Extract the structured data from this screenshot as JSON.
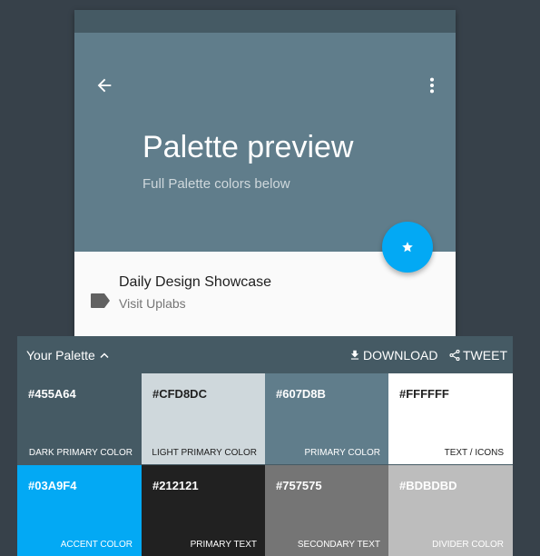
{
  "preview": {
    "title": "Palette preview",
    "subtitle": "Full Palette colors below",
    "list_item_title": "Daily Design Showcase",
    "list_item_subtitle": "Visit Uplabs",
    "icons": {
      "back": "arrow-back-icon",
      "more": "more-vert-icon",
      "fab": "star-icon",
      "label": "label-icon"
    }
  },
  "palette": {
    "title": "Your Palette",
    "download_label": "DOWNLOAD",
    "tweet_label": "TWEET",
    "swatches": [
      {
        "hex": "#455A64",
        "name": "DARK PRIMARY COLOR",
        "color": "#455A64",
        "text_color": "#FFFFFF"
      },
      {
        "hex": "#CFD8DC",
        "name": "LIGHT PRIMARY COLOR",
        "color": "#CFD8DC",
        "text_color": "#212121"
      },
      {
        "hex": "#607D8B",
        "name": "PRIMARY COLOR",
        "color": "#607D8B",
        "text_color": "#FFFFFF"
      },
      {
        "hex": "#FFFFFF",
        "name": "TEXT / ICONS",
        "color": "#FFFFFF",
        "text_color": "#212121"
      },
      {
        "hex": "#03A9F4",
        "name": "ACCENT COLOR",
        "color": "#03A9F4",
        "text_color": "#FFFFFF"
      },
      {
        "hex": "#212121",
        "name": "PRIMARY TEXT",
        "color": "#212121",
        "text_color": "#FFFFFF"
      },
      {
        "hex": "#757575",
        "name": "SECONDARY TEXT",
        "color": "#757575",
        "text_color": "#FFFFFF"
      },
      {
        "hex": "#BDBDBD",
        "name": "DIVIDER COLOR",
        "color": "#BDBDBD",
        "text_color": "#FFFFFF"
      }
    ]
  },
  "colors": {
    "background": "#37414A",
    "status_bar": "#455A64",
    "header": "#607D8B",
    "accent": "#03A9F4",
    "surface": "#FAFAFA"
  }
}
